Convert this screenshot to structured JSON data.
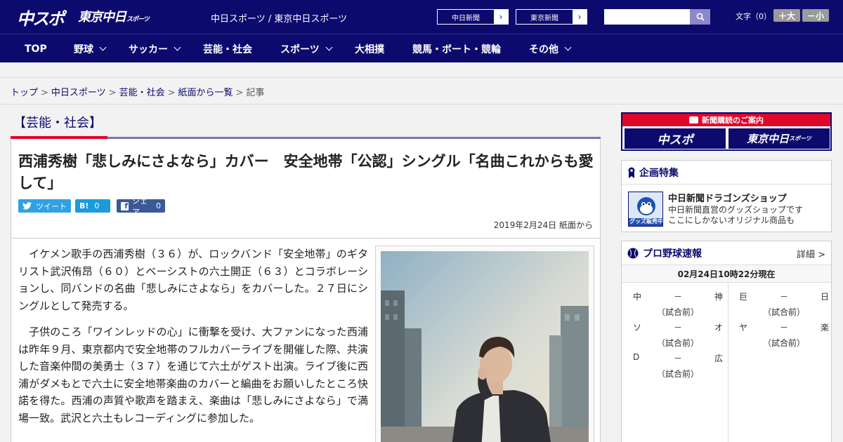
{
  "header": {
    "logo_primary": "中スポ",
    "logo_secondary": "東京中日",
    "logo_secondary_sub": "スポーツ",
    "site_title": "中日スポーツ / 東京中日スポーツ",
    "links": [
      {
        "label": "中日新聞"
      },
      {
        "label": "東京新聞"
      }
    ],
    "search": {
      "placeholder": ""
    },
    "font_size_label": "文字（0）",
    "font_plus_label": "＋大",
    "font_minus_label": "－小"
  },
  "nav": {
    "items": [
      {
        "label": "TOP",
        "has_menu": false
      },
      {
        "label": "野球",
        "has_menu": true
      },
      {
        "label": "サッカー",
        "has_menu": true
      },
      {
        "label": "芸能・社会",
        "has_menu": false
      },
      {
        "label": "スポーツ",
        "has_menu": true
      },
      {
        "label": "大相撲",
        "has_menu": false
      },
      {
        "label": "競馬・ボート・競輪",
        "has_menu": false
      },
      {
        "label": "その他",
        "has_menu": true
      }
    ]
  },
  "breadcrumb": {
    "items": [
      "トップ",
      "中日スポーツ",
      "芸能・社会",
      "紙面から一覧"
    ],
    "current": "記事"
  },
  "article": {
    "category": "【芸能・社会】",
    "headline": "西浦秀樹「悲しみにさよなら」カバー　安全地帯「公認」シングル「名曲これからも愛して」",
    "share": {
      "tweet_label": "ツイート",
      "hatena_label": "B!",
      "hatena_count": "0",
      "facebook_label": "シェア",
      "facebook_count": "0"
    },
    "date": "2019年2月24日",
    "source": "紙面から",
    "paragraphs": [
      "イケメン歌手の西浦秀樹（３６）が、ロックバンド「安全地帯」のギタリスト武沢侑昂（６０）とベーシストの六土開正（６３）とコラボレーションし、同バンドの名曲「悲しみにさよなら」をカバーした。２７日にシングルとして発売する。",
      "子供のころ「ワインレッドの心」に衝撃を受け、大ファンになった西浦は昨年９月、東京都内で安全地帯のフルカバーライブを開催した際、共演した音楽仲間の美勇士（３７）を通じて六土がゲスト出演。ライブ後に西浦がダメもとで六土に安全地帯楽曲のカバーと編曲をお願いしたところ快諾を得た。西浦の声質や歌声を踏まえ、楽曲は「悲しみにさよなら」で満場一致。武沢と六土もレコーディングに参加した。"
    ]
  },
  "sidebar": {
    "subscribe": {
      "title": "新聞購読のご案内",
      "button1": "中スポ",
      "button2": "東京中日",
      "button2_sub": "スポーツ"
    },
    "feature": {
      "title": "企画特集",
      "item_title": "中日新聞ドラゴンズショップ",
      "item_desc_line1": "中日新聞直営のグッズショップです",
      "item_desc_line2": "ここにしかないオリジナル商品も",
      "thumb_caption": "グッズ販売中"
    },
    "scores": {
      "title": "プロ野球速報",
      "detail_link": "詳細 >",
      "timestamp": "02月24日10時22分現在",
      "games": [
        {
          "home": "中",
          "vs": "－",
          "away": "神",
          "status": "（試合前）"
        },
        {
          "home": "巨",
          "vs": "－",
          "away": "日",
          "status": "（試合前）"
        },
        {
          "home": "ソ",
          "vs": "－",
          "away": "オ",
          "status": "（試合前）"
        },
        {
          "home": "ヤ",
          "vs": "－",
          "away": "楽",
          "status": "（試合前）"
        },
        {
          "home": "D",
          "vs": "－",
          "away": "広",
          "status": "（試合前）"
        }
      ]
    }
  },
  "colors": {
    "brand_navy": "#0d0a6e",
    "accent_red": "#e0052a",
    "twitter": "#2ea2e3",
    "hatena": "#1c9bd8",
    "facebook": "#3b5998"
  }
}
